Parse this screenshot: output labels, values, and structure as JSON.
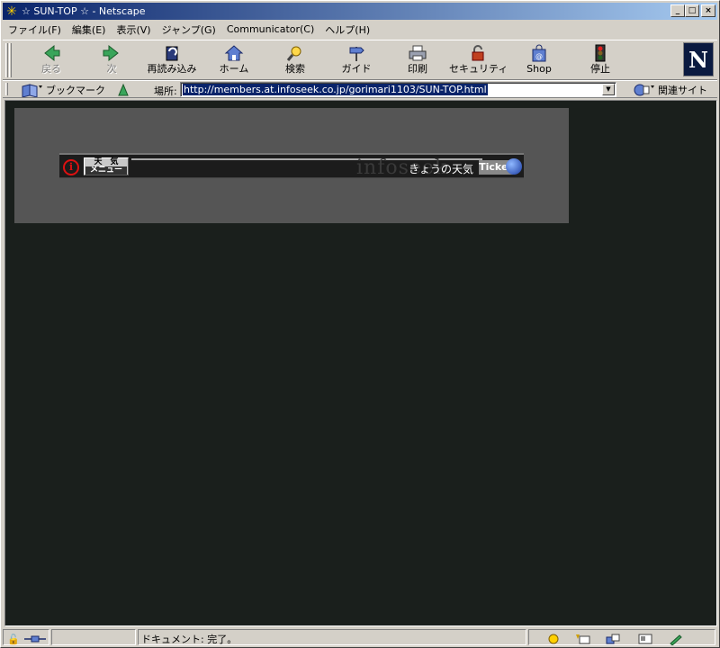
{
  "window": {
    "title": "☆ SUN-TOP ☆ - Netscape",
    "minimize": "_",
    "maximize": "□",
    "close": "×"
  },
  "menubar": {
    "items": [
      {
        "label": "ファイル(F)"
      },
      {
        "label": "編集(E)"
      },
      {
        "label": "表示(V)"
      },
      {
        "label": "ジャンプ(G)"
      },
      {
        "label": "Communicator(C)"
      },
      {
        "label": "ヘルプ(H)"
      }
    ]
  },
  "toolbar": {
    "back": "戻る",
    "forward": "次",
    "reload": "再読み込み",
    "home": "ホーム",
    "search": "検索",
    "guide": "ガイド",
    "print": "印刷",
    "security": "セキュリティ",
    "shop": "Shop",
    "stop": "停止",
    "logo": "N"
  },
  "location": {
    "bookmarks_label": "ブックマーク",
    "location_label": "場所:",
    "url": "http://members.at.infoseek.co.jp/gorimari1103/SUN-TOP.html",
    "related_label": "関連サイト"
  },
  "ticker": {
    "info_glyph": "i",
    "menu_top": "天　気",
    "menu_bottom": "メニュー",
    "watermark": "infoseek",
    "weather_text": "きょうの天気",
    "tag": "Ticker"
  },
  "statusbar": {
    "text": "ドキュメント: 完了。"
  },
  "colors": {
    "titlebar_start": "#0a246a",
    "titlebar_end": "#a6caf0",
    "content_bg": "#1a1f1c",
    "panel_bg": "#555555"
  }
}
